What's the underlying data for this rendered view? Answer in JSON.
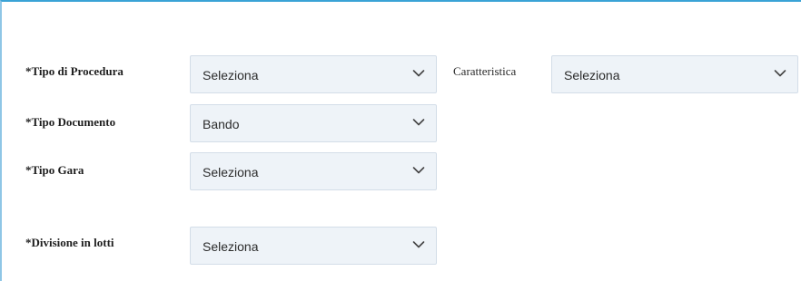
{
  "form": {
    "tipo_procedura": {
      "label": "*Tipo di Procedura",
      "value": "Seleziona"
    },
    "caratteristica": {
      "label": "Caratteristica",
      "value": "Seleziona"
    },
    "tipo_documento": {
      "label": "*Tipo Documento",
      "value": "Bando"
    },
    "tipo_gara": {
      "label": "*Tipo Gara",
      "value": "Seleziona"
    },
    "divisione_lotti": {
      "label": "*Divisione in lotti",
      "value": "Seleziona"
    }
  },
  "icons": {
    "dropdown": "chevron-down-icon"
  },
  "colors": {
    "select_bg": "#eef3f8",
    "select_border": "#d3dde8",
    "panel_border": "#3aa3d6"
  }
}
